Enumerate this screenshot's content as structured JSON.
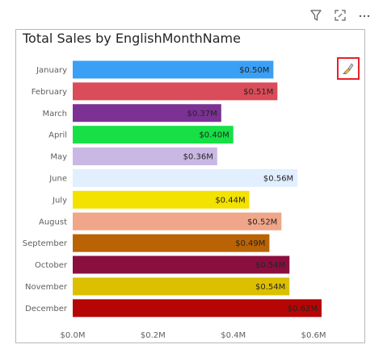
{
  "visual": {
    "title": "Total Sales by EnglishMonthName"
  },
  "toolbar": {
    "filter_icon": "filter-icon",
    "focus_icon": "focus-mode-icon",
    "more_icon": "more-options-icon"
  },
  "format_button": {
    "icon": "paintbrush-icon"
  },
  "chart_data": {
    "type": "bar",
    "orientation": "horizontal",
    "title": "Total Sales by EnglishMonthName",
    "categories": [
      "January",
      "February",
      "March",
      "April",
      "May",
      "June",
      "July",
      "August",
      "September",
      "October",
      "November",
      "December"
    ],
    "values": [
      0.5,
      0.51,
      0.37,
      0.4,
      0.36,
      0.56,
      0.44,
      0.52,
      0.49,
      0.54,
      0.54,
      0.62
    ],
    "value_labels": [
      "$0.50M",
      "$0.51M",
      "$0.37M",
      "$0.40M",
      "$0.36M",
      "$0.56M",
      "$0.44M",
      "$0.52M",
      "$0.49M",
      "$0.54M",
      "$0.54M",
      "$0.62M"
    ],
    "colors": [
      "#3aa0f5",
      "#da4c59",
      "#7b3294",
      "#16e046",
      "#c9b8e4",
      "#e1efff",
      "#f3e200",
      "#f0a689",
      "#b96304",
      "#8a0f3e",
      "#dcc000",
      "#b50505"
    ],
    "xticks": [
      "$0.0M",
      "$0.2M",
      "$0.4M",
      "$0.6M"
    ],
    "xlim": [
      0,
      0.65
    ],
    "grid": false,
    "legend": "none"
  }
}
